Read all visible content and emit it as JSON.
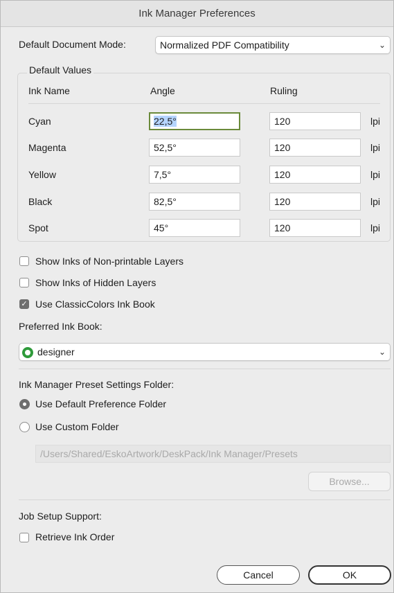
{
  "window": {
    "title": "Ink Manager Preferences"
  },
  "document_mode": {
    "label": "Default Document Mode:",
    "value": "Normalized PDF Compatibility"
  },
  "default_values": {
    "title": "Default Values",
    "headers": {
      "ink_name": "Ink Name",
      "angle": "Angle",
      "ruling": "Ruling"
    },
    "unit": "lpi",
    "rows": [
      {
        "name": "Cyan",
        "angle": "22,5°",
        "ruling": "120"
      },
      {
        "name": "Magenta",
        "angle": "52,5°",
        "ruling": "120"
      },
      {
        "name": "Yellow",
        "angle": "7,5°",
        "ruling": "120"
      },
      {
        "name": "Black",
        "angle": "82,5°",
        "ruling": "120"
      },
      {
        "name": "Spot",
        "angle": "45°",
        "ruling": "120"
      }
    ]
  },
  "options": {
    "non_printable": {
      "label": "Show Inks of Non-printable Layers",
      "checked": false
    },
    "hidden_layers": {
      "label": "Show Inks of Hidden Layers",
      "checked": false
    },
    "classic_colors": {
      "label": "Use ClassicColors Ink Book",
      "checked": true
    }
  },
  "ink_book": {
    "label": "Preferred Ink Book:",
    "value": "designer",
    "icon": "ink-book-circle-icon",
    "icon_color": "#2e9a3a"
  },
  "preset_folder": {
    "label": "Ink Manager Preset Settings Folder:",
    "default_option": "Use Default Preference Folder",
    "custom_option": "Use Custom Folder",
    "selected": "default",
    "path": "/Users/Shared/EskoArtwork/DeskPack/Ink Manager/Presets",
    "browse_label": "Browse..."
  },
  "job_setup": {
    "label": "Job Setup Support:",
    "retrieve_order": {
      "label": "Retrieve Ink Order",
      "checked": false
    }
  },
  "buttons": {
    "cancel": "Cancel",
    "ok": "OK"
  }
}
